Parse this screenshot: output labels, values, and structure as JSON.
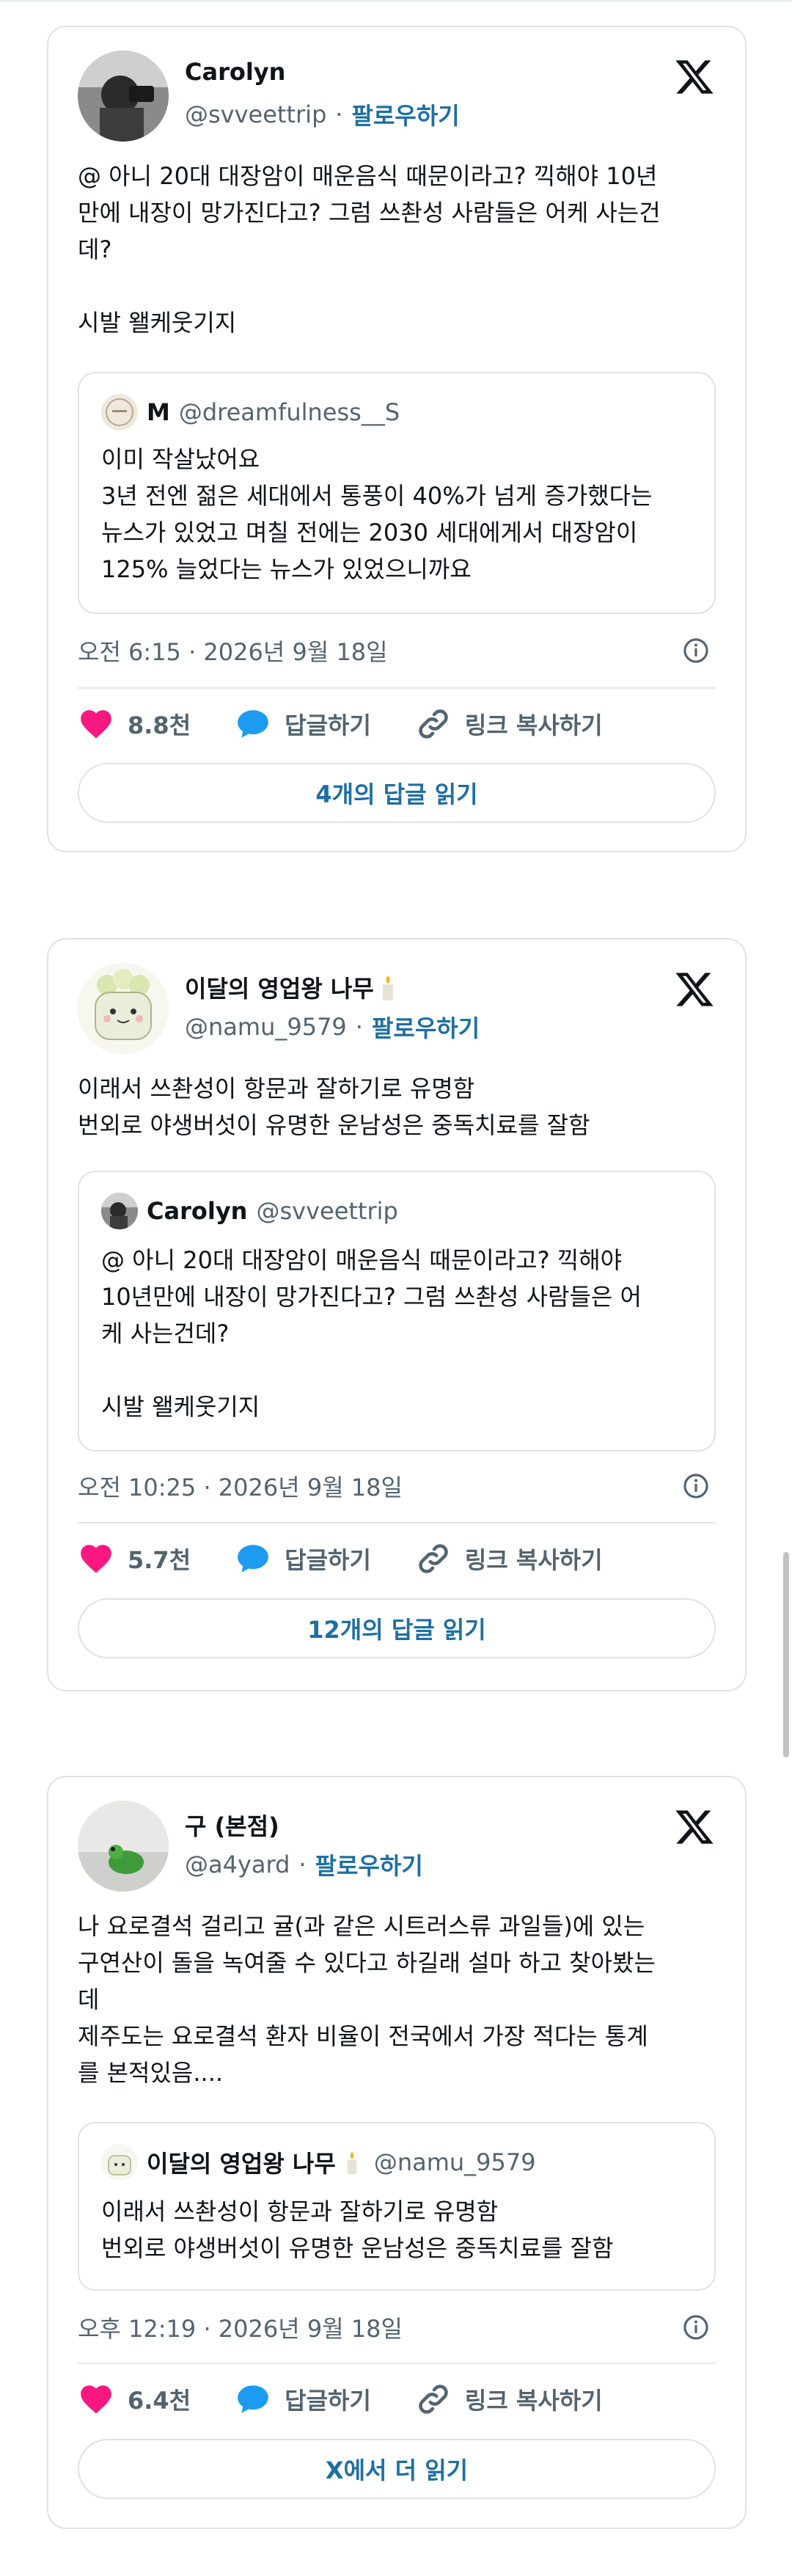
{
  "tweets": [
    {
      "name": "Carolyn",
      "handle": "@svveettrip",
      "follow": "팔로우하기",
      "text": "@ 아니 20대 대장암이 매운음식 때문이라고? 끽해야 10년\n만에 내장이 망가진다고? 그럼 쓰촨성 사람들은 어케 사는건\n데?\n\n시발 왤케웃기지",
      "quote": {
        "name": "M",
        "handle": "@dreamfulness__S",
        "text": "이미 작살났어요\n3년 전엔 젊은 세대에서 통풍이 40%가 넘게 증가했다는\n뉴스가 있었고 며칠 전에는 2030 세대에게서 대장암이\n125% 늘었다는 뉴스가 있었으니까요"
      },
      "time": "오전 6:15 · 2026년 9월 18일",
      "likes": "8.8천",
      "reply": "답글하기",
      "copy": "링크 복사하기",
      "read": "4개의 답글 읽기"
    },
    {
      "name": "이달의 영업왕 나무",
      "handle": "@namu_9579",
      "follow": "팔로우하기",
      "text": "이래서 쓰촨성이 항문과 잘하기로 유명함\n번외로 야생버섯이 유명한 운남성은 중독치료를 잘함",
      "quote": {
        "name": "Carolyn",
        "handle": "@svveettrip",
        "text": "@ 아니 20대 대장암이 매운음식 때문이라고? 끽해야\n10년만에 내장이 망가진다고? 그럼 쓰촨성 사람들은 어\n케 사는건데?\n\n시발 왤케웃기지"
      },
      "time": "오전 10:25 · 2026년 9월 18일",
      "likes": "5.7천",
      "reply": "답글하기",
      "copy": "링크 복사하기",
      "read": "12개의 답글 읽기"
    },
    {
      "name": "구 (본점)",
      "handle": "@a4yard",
      "follow": "팔로우하기",
      "text": "나 요로결석 걸리고 귤(과 같은 시트러스류 과일들)에 있는\n구연산이 돌을 녹여줄 수 있다고 하길래 설마 하고 찾아봤는\n데\n제주도는 요로결석 환자 비율이 전국에서 가장 적다는 통계\n를 본적있음....",
      "quote": {
        "name": "이달의 영업왕 나무",
        "handle": "@namu_9579",
        "text": "이래서 쓰촨성이 항문과 잘하기로 유명함\n번외로 야생버섯이 유명한 운남성은 중독치료를 잘함"
      },
      "time": "오후 12:19 · 2026년 9월 18일",
      "likes": "6.4천",
      "reply": "답글하기",
      "copy": "링크 복사하기",
      "read": "X에서 더 읽기"
    }
  ],
  "colors": {
    "heart": "#f91880",
    "reply": "#1d9bf0",
    "link_blue": "#1d6fa3",
    "muted": "#536471",
    "border": "#dfe3e6"
  }
}
